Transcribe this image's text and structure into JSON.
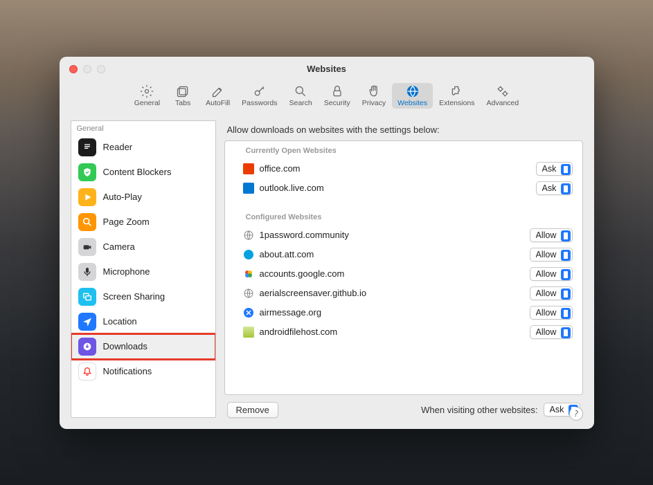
{
  "window": {
    "title": "Websites"
  },
  "toolbar": {
    "items": [
      {
        "id": "general",
        "label": "General"
      },
      {
        "id": "tabs",
        "label": "Tabs"
      },
      {
        "id": "autofill",
        "label": "AutoFill"
      },
      {
        "id": "passwords",
        "label": "Passwords"
      },
      {
        "id": "search",
        "label": "Search"
      },
      {
        "id": "security",
        "label": "Security"
      },
      {
        "id": "privacy",
        "label": "Privacy"
      },
      {
        "id": "websites",
        "label": "Websites",
        "selected": true
      },
      {
        "id": "extensions",
        "label": "Extensions"
      },
      {
        "id": "advanced",
        "label": "Advanced"
      }
    ]
  },
  "sidebar": {
    "header": "General",
    "items": [
      {
        "id": "reader",
        "label": "Reader",
        "iconColor": "#1c1c1c"
      },
      {
        "id": "content-blockers",
        "label": "Content Blockers",
        "iconColor": "#32c955"
      },
      {
        "id": "auto-play",
        "label": "Auto-Play",
        "iconColor": "#ffb21a"
      },
      {
        "id": "page-zoom",
        "label": "Page Zoom",
        "iconColor": "#ff9500"
      },
      {
        "id": "camera",
        "label": "Camera",
        "iconColor": "#d5d5d7"
      },
      {
        "id": "microphone",
        "label": "Microphone",
        "iconColor": "#d5d5d7"
      },
      {
        "id": "screen-sharing",
        "label": "Screen Sharing",
        "iconColor": "#1fc0f0"
      },
      {
        "id": "location",
        "label": "Location",
        "iconColor": "#1f78ff"
      },
      {
        "id": "downloads",
        "label": "Downloads",
        "iconColor": "#6e55e4",
        "highlighted": true
      },
      {
        "id": "notifications",
        "label": "Notifications",
        "iconColor": "#ffffff"
      }
    ]
  },
  "main": {
    "heading": "Allow downloads on websites with the settings below:",
    "sections": {
      "open": {
        "title": "Currently Open Websites",
        "rows": [
          {
            "site": "office.com",
            "value": "Ask",
            "faviconColor": "#eb3c00"
          },
          {
            "site": "outlook.live.com",
            "value": "Ask",
            "faviconColor": "#1f78ff"
          }
        ]
      },
      "configured": {
        "title": "Configured Websites",
        "rows": [
          {
            "site": "1password.community",
            "value": "Allow"
          },
          {
            "site": "about.att.com",
            "value": "Allow",
            "faviconColor": "#06a1e0"
          },
          {
            "site": "accounts.google.com",
            "value": "Allow"
          },
          {
            "site": "aerialscreensaver.github.io",
            "value": "Allow"
          },
          {
            "site": "airmessage.org",
            "value": "Allow",
            "faviconColor": "#1f78ff"
          },
          {
            "site": "androidfilehost.com",
            "value": "Allow",
            "faviconColor": "#a4c639"
          }
        ]
      }
    },
    "footer": {
      "remove": "Remove",
      "visitingLabel": "When visiting other websites:",
      "visitingValue": "Ask"
    }
  }
}
